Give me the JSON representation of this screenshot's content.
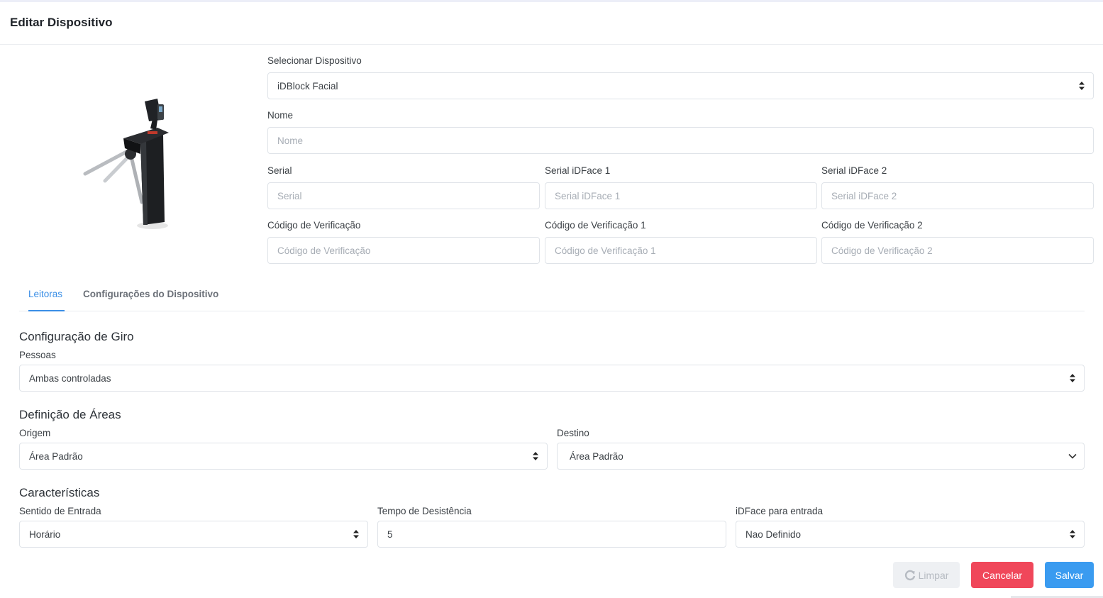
{
  "header": {
    "title": "Editar Dispositivo"
  },
  "device": {
    "image_icon": "turnstile-device-image",
    "select_label": "Selecionar Dispositivo",
    "select_value": "iDBlock Facial",
    "nome_label": "Nome",
    "nome_placeholder": "Nome",
    "serial_label": "Serial",
    "serial_placeholder": "Serial",
    "serial1_label": "Serial iDFace 1",
    "serial1_placeholder": "Serial iDFace 1",
    "serial2_label": "Serial iDFace 2",
    "serial2_placeholder": "Serial iDFace 2",
    "codigo_label": "Código de Verificação",
    "codigo_placeholder": "Código de Verificação",
    "codigo1_label": "Código de Verificação 1",
    "codigo1_placeholder": "Código de Verificação 1",
    "codigo2_label": "Código de Verificação 2",
    "codigo2_placeholder": "Código de Verificação 2"
  },
  "tabs": [
    {
      "label": "Leitoras",
      "active": true
    },
    {
      "label": "Configurações do Dispositivo",
      "active": false
    }
  ],
  "giro": {
    "title": "Configuração de Giro",
    "pessoas_label": "Pessoas",
    "pessoas_value": "Ambas controladas"
  },
  "areas": {
    "title": "Definição de Áreas",
    "origem_label": "Origem",
    "origem_value": "Área Padrão",
    "destino_label": "Destino",
    "destino_value": "Área Padrão"
  },
  "caracteristicas": {
    "title": "Características",
    "sentido_label": "Sentido de Entrada",
    "sentido_value": "Horário",
    "tempo_label": "Tempo de Desistência",
    "tempo_value": "5",
    "idface_label": "iDFace para entrada",
    "idface_value": "Nao Definido"
  },
  "actions": {
    "clear_label": "Limpar",
    "cancel_label": "Cancelar",
    "save_label": "Salvar"
  },
  "colors": {
    "accent": "#3a8ee6",
    "cancel": "#f0475a",
    "save": "#3a9bf0"
  }
}
